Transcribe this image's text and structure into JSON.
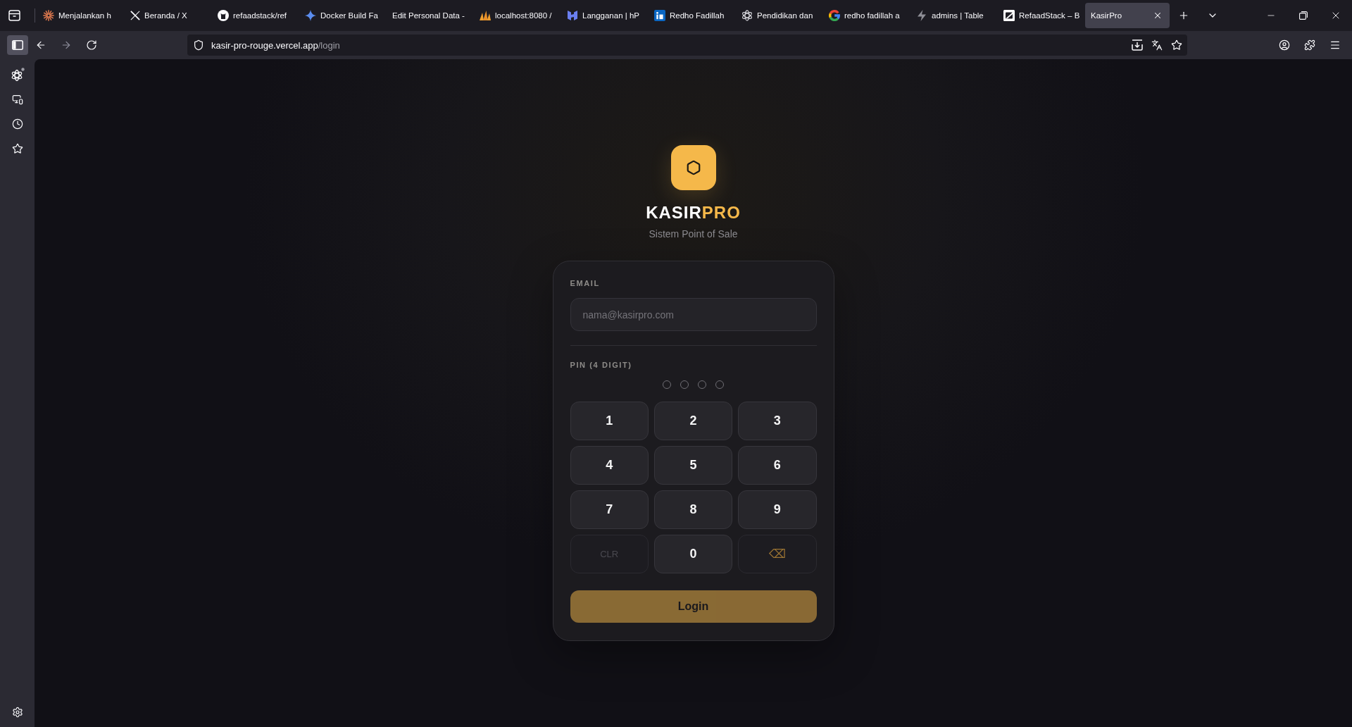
{
  "browser": {
    "tabs": [
      {
        "title": "Menjalankan h",
        "kind": "sunburst",
        "selected": false
      },
      {
        "title": "Beranda / X",
        "kind": "cross",
        "selected": false
      },
      {
        "title": "refaadstack/ref",
        "kind": "cat",
        "selected": false
      },
      {
        "title": "Docker Build Fa",
        "kind": "sparkle",
        "selected": false
      },
      {
        "title": "Edit Personal Data -",
        "kind": "plain",
        "selected": false
      },
      {
        "title": "localhost:8080 /",
        "kind": "sails",
        "selected": false
      },
      {
        "title": "Langganan | hP",
        "kind": "bracket",
        "selected": false
      },
      {
        "title": "Redho Fadillah",
        "kind": "square",
        "selected": false
      },
      {
        "title": "Pendidikan dan",
        "kind": "knot",
        "selected": false
      },
      {
        "title": "redho fadillah a",
        "kind": "ring",
        "selected": false
      },
      {
        "title": "admins | Table",
        "kind": "bolt",
        "selected": false
      },
      {
        "title": "RefaadStack – B",
        "kind": "tile",
        "selected": false
      },
      {
        "title": "KasirPro",
        "kind": "plain",
        "selected": true
      }
    ],
    "address_bar": {
      "host": "kasir-pro-rouge.vercel.app",
      "path": "/login"
    }
  },
  "login": {
    "brand": {
      "name": "KASIR",
      "accent": "PRO"
    },
    "subtitle": "Sistem Point of Sale",
    "email": {
      "label": "EMAIL",
      "placeholder": "nama@kasirpro.com"
    },
    "pin": {
      "label": "PIN (4 DIGIT)",
      "dots": [
        {
          "filled": false
        },
        {
          "filled": false
        },
        {
          "filled": false
        },
        {
          "filled": false
        }
      ]
    },
    "keypad": [
      {
        "label": "1",
        "kind": "digit",
        "disabled": false
      },
      {
        "label": "2",
        "kind": "digit",
        "disabled": false
      },
      {
        "label": "3",
        "kind": "digit",
        "disabled": false
      },
      {
        "label": "4",
        "kind": "digit",
        "disabled": false
      },
      {
        "label": "5",
        "kind": "digit",
        "disabled": false
      },
      {
        "label": "6",
        "kind": "digit",
        "disabled": false
      },
      {
        "label": "7",
        "kind": "digit",
        "disabled": false
      },
      {
        "label": "8",
        "kind": "digit",
        "disabled": false
      },
      {
        "label": "9",
        "kind": "digit",
        "disabled": false
      },
      {
        "label": "CLR",
        "kind": "clear",
        "disabled": true
      },
      {
        "label": "0",
        "kind": "digit",
        "disabled": false
      },
      {
        "label": "⌫",
        "kind": "backspace",
        "disabled": true
      }
    ],
    "login_button": {
      "label": "Login",
      "disabled": true
    }
  }
}
